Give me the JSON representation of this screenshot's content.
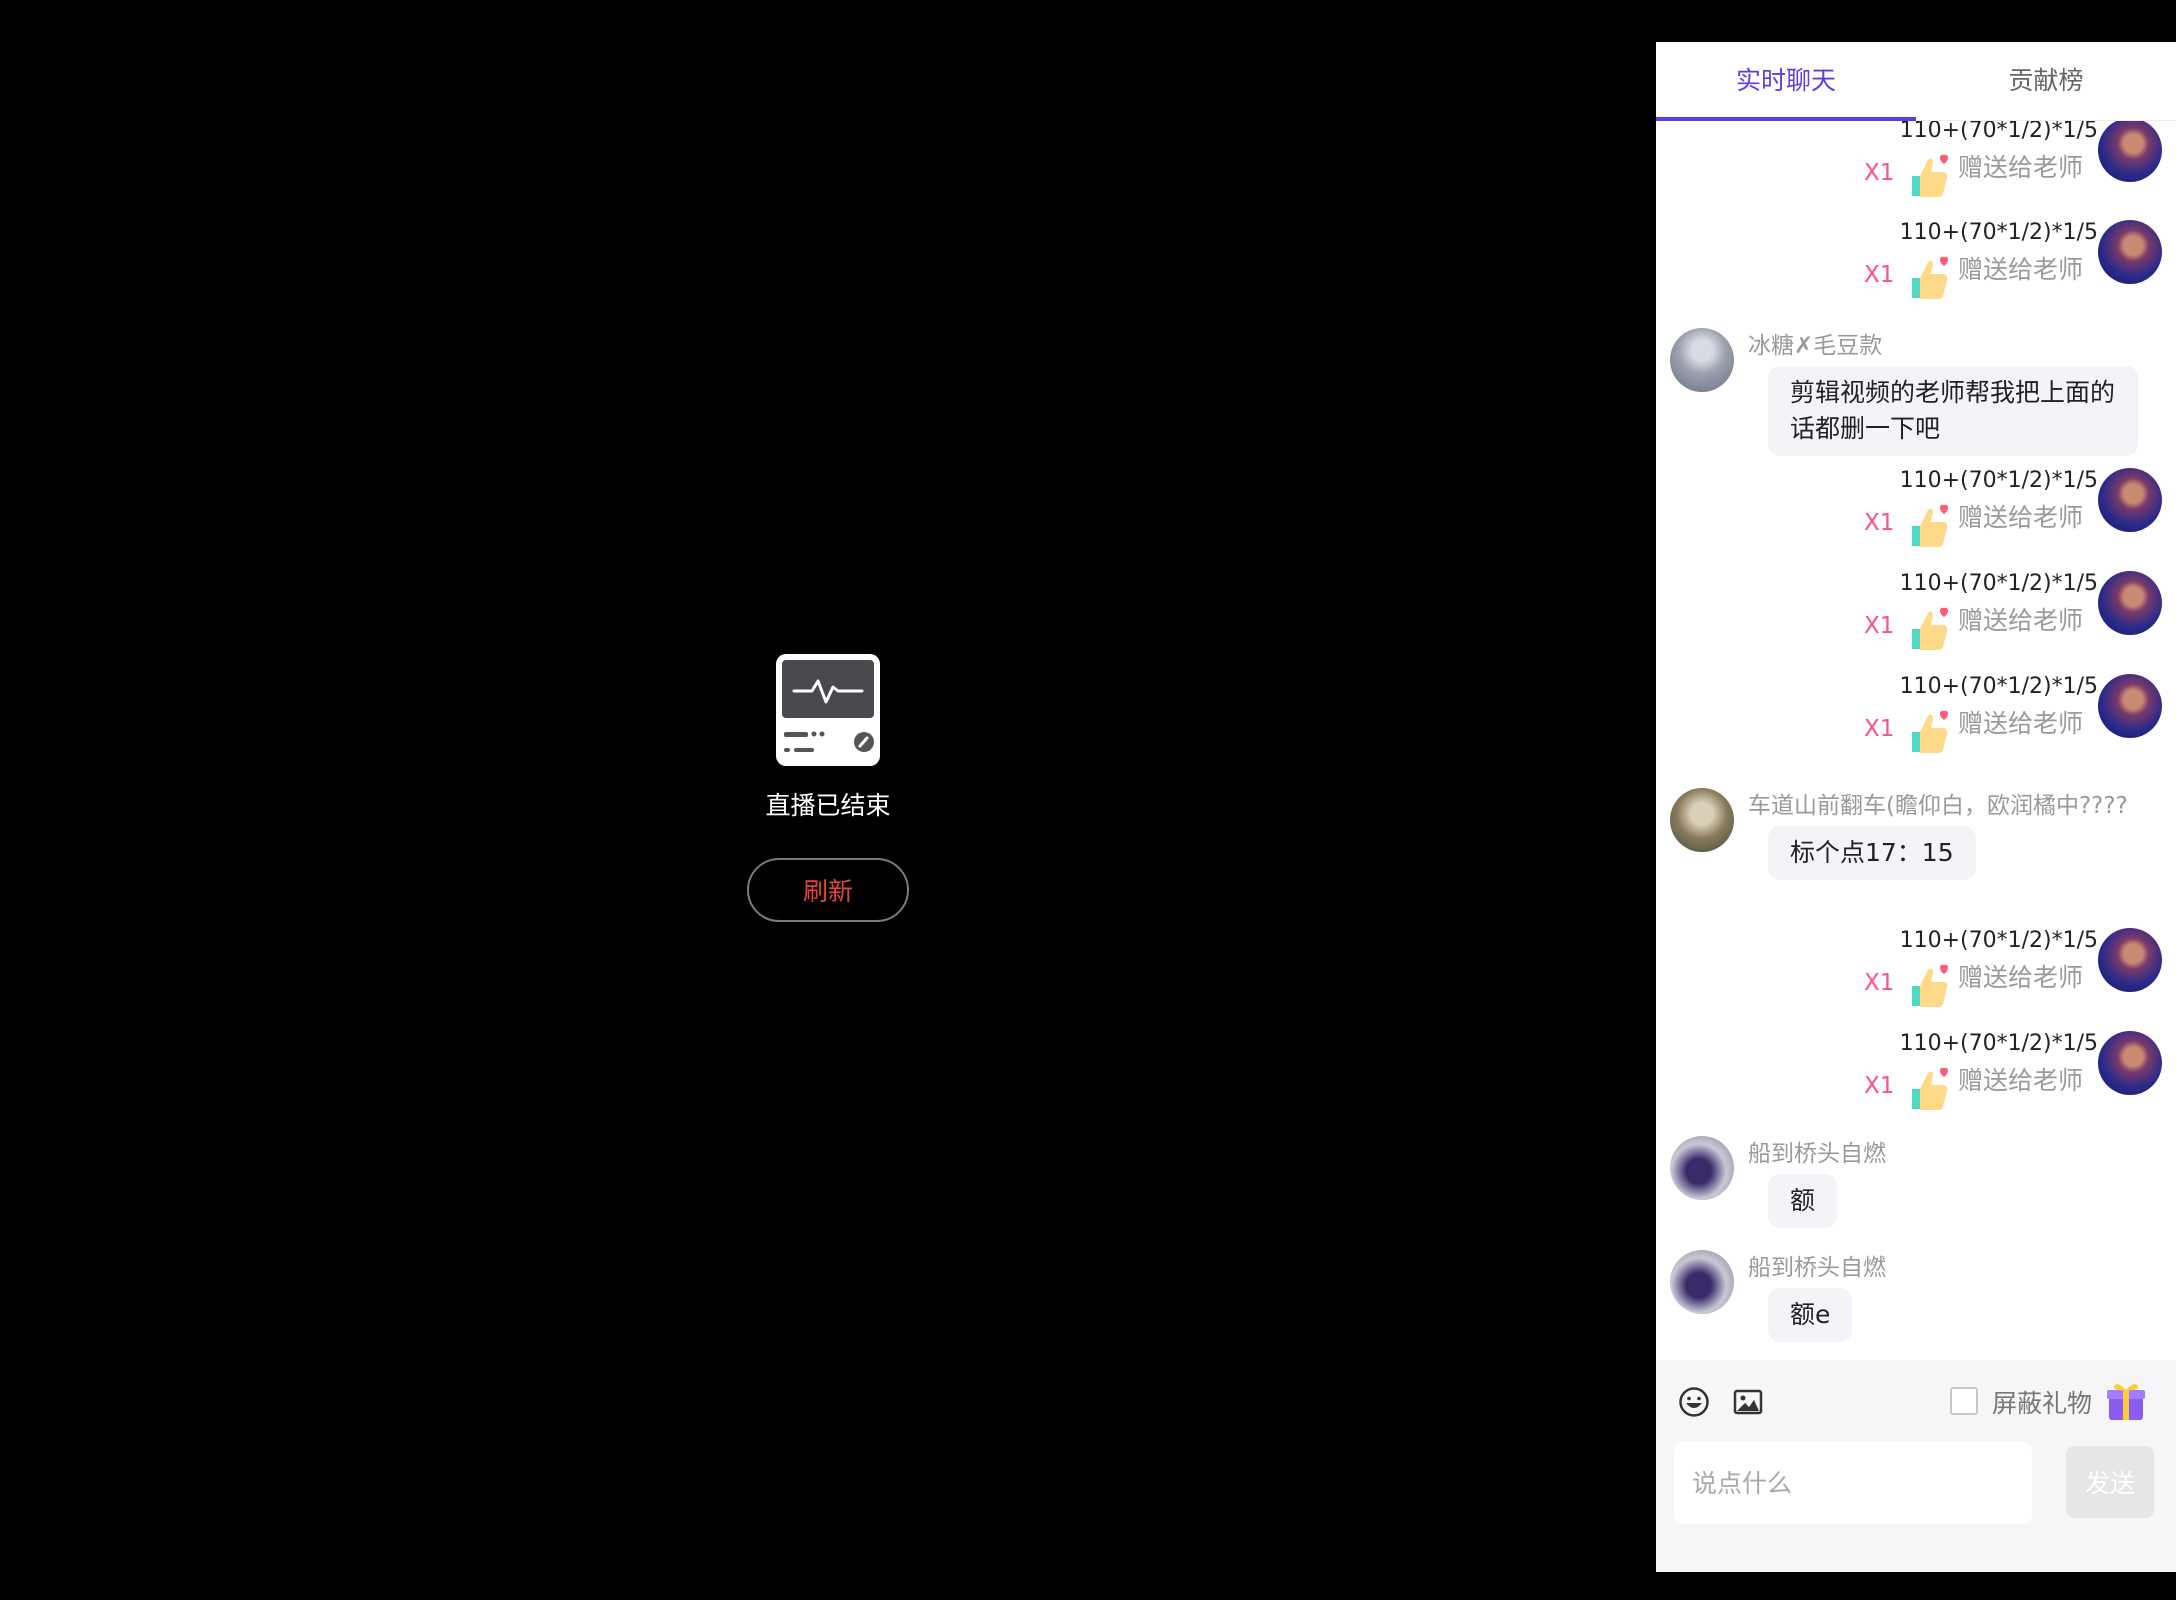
{
  "player": {
    "status_text": "直播已结束",
    "refresh_label": "刷新"
  },
  "tabs": [
    {
      "label": "实时聊天",
      "active": true
    },
    {
      "label": "贡献榜",
      "active": false
    }
  ],
  "chat": {
    "messages": [
      {
        "type": "gift",
        "sender": "110+(70*1/2)*1/5",
        "gift_name": "赠送给老师",
        "count": "X1",
        "icon": "thumbs-up-heart-icon"
      },
      {
        "type": "gift",
        "sender": "110+(70*1/2)*1/5",
        "gift_name": "赠送给老师",
        "count": "X1",
        "icon": "thumbs-up-heart-icon"
      },
      {
        "type": "text",
        "sender": "冰糖✗毛豆款",
        "text": "剪辑视频的老师帮我把上面的话都删一下吧"
      },
      {
        "type": "gift",
        "sender": "110+(70*1/2)*1/5",
        "gift_name": "赠送给老师",
        "count": "X1",
        "icon": "thumbs-up-heart-icon"
      },
      {
        "type": "gift",
        "sender": "110+(70*1/2)*1/5",
        "gift_name": "赠送给老师",
        "count": "X1",
        "icon": "thumbs-up-heart-icon"
      },
      {
        "type": "gift",
        "sender": "110+(70*1/2)*1/5",
        "gift_name": "赠送给老师",
        "count": "X1",
        "icon": "thumbs-up-heart-icon"
      },
      {
        "type": "text",
        "sender": "车道山前翻车(瞻仰白，欧润橘中????",
        "text": "标个点17：15"
      },
      {
        "type": "gift",
        "sender": "110+(70*1/2)*1/5",
        "gift_name": "赠送给老师",
        "count": "X1",
        "icon": "thumbs-up-heart-icon"
      },
      {
        "type": "gift",
        "sender": "110+(70*1/2)*1/5",
        "gift_name": "赠送给老师",
        "count": "X1",
        "icon": "thumbs-up-heart-icon"
      },
      {
        "type": "text",
        "sender": "船到桥头自燃",
        "text": "额"
      },
      {
        "type": "text",
        "sender": "船到桥头自燃",
        "text": "额e"
      },
      {
        "type": "text",
        "sender": "船到桥头自燃",
        "text": ""
      }
    ]
  },
  "composer": {
    "shield_gifts_label": "屏蔽礼物",
    "shield_gifts_checked": false,
    "input_placeholder": "说点什么",
    "send_label": "发送"
  },
  "colors": {
    "accent": "#5b3ee6",
    "gift_count": "#ff4f8b",
    "refresh_text": "#e5453f"
  }
}
